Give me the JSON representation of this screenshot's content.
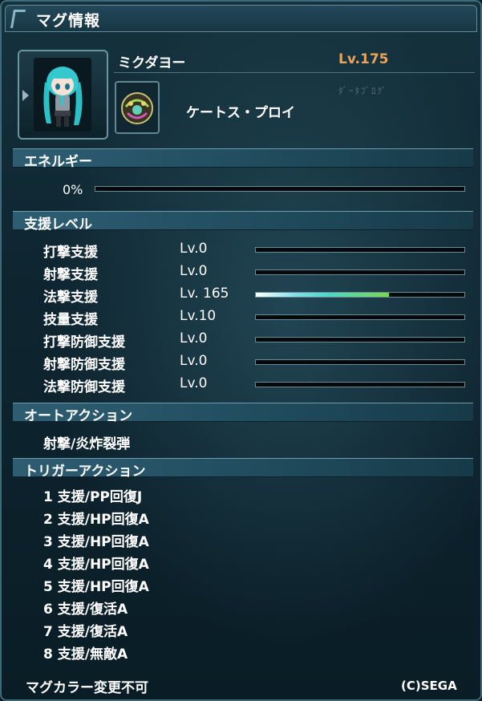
{
  "window": {
    "title": "マグ情報"
  },
  "mag": {
    "name": "ミクダヨー",
    "level": "Lv.175",
    "form_name": "ケートス・プロイ",
    "watermark": "ﾀﾞｰﾀﾌﾞﾛｸﾞ"
  },
  "energy": {
    "label": "エネルギー",
    "percent_text": "0%",
    "percent": 0
  },
  "support": {
    "label": "支援レベル",
    "rows": [
      {
        "name": "打撃支援",
        "level": "Lv.0",
        "fill": 0
      },
      {
        "name": "射撃支援",
        "level": "Lv.0",
        "fill": 0
      },
      {
        "name": "法撃支援",
        "level": "Lv. 165",
        "fill": 0.64
      },
      {
        "name": "技量支援",
        "level": "Lv.10",
        "fill": 0
      },
      {
        "name": "打撃防御支援",
        "level": "Lv.0",
        "fill": 0
      },
      {
        "name": "射撃防御支援",
        "level": "Lv.0",
        "fill": 0
      },
      {
        "name": "法撃防御支援",
        "level": "Lv.0",
        "fill": 0
      }
    ]
  },
  "auto_action": {
    "label": "オートアクション",
    "item": "射撃/炎炸裂弾"
  },
  "trigger_action": {
    "label": "トリガーアクション",
    "items": [
      "1 支援/PP回復J",
      "2 支援/HP回復A",
      "3 支援/HP回復A",
      "4 支援/HP回復A",
      "5 支援/HP回復A",
      "6 支援/復活A",
      "7 支援/復活A",
      "8 支援/無敵A"
    ]
  },
  "footer": {
    "color_note": "マグカラー変更不可",
    "copyright": "(C)SEGA"
  },
  "colors": {
    "level_accent": "#e8a45a",
    "section_bg": "#2e5d72"
  }
}
